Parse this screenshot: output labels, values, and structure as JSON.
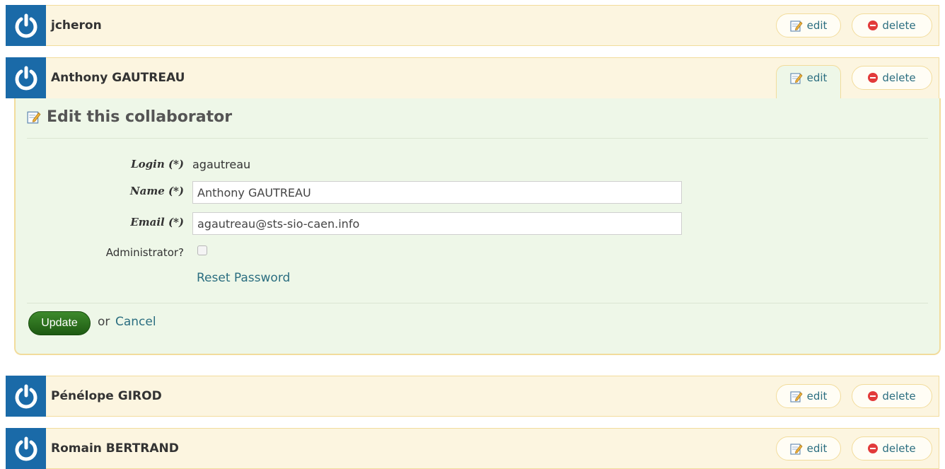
{
  "rows": [
    {
      "name": "jcheron",
      "edit_label": "edit",
      "delete_label": "delete"
    },
    {
      "name": "Anthony GAUTREAU",
      "edit_label": "edit",
      "delete_label": "delete"
    },
    {
      "name": "Pénélope GIROD",
      "edit_label": "edit",
      "delete_label": "delete"
    },
    {
      "name": "Romain BERTRAND",
      "edit_label": "edit",
      "delete_label": "delete"
    }
  ],
  "form": {
    "title": "Edit this collaborator",
    "login_label": "Login (*)",
    "login_value": "agautreau",
    "name_label": "Name (*)",
    "name_value": "Anthony GAUTREAU",
    "email_label": "Email (*)",
    "email_value": "agautreau@sts-sio-caen.info",
    "admin_label": "Administrator?",
    "reset_link": "Reset Password",
    "update_label": "Update",
    "or_text": "or",
    "cancel_label": "Cancel"
  },
  "colors": {
    "avatar_bg": "#1a6aa8",
    "row_bg": "#fcf5e0",
    "panel_bg": "#eef7e8",
    "link": "#2b6e80",
    "update_bg": "#2f7a20",
    "delete_icon": "#e23a3a"
  },
  "icons": {
    "avatar": "power-icon",
    "edit": "pencil-icon",
    "delete": "minus-circle-icon"
  }
}
